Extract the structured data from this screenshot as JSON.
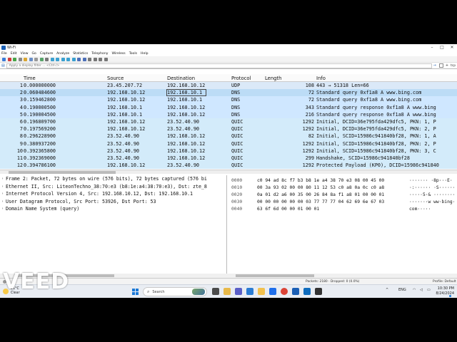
{
  "window": {
    "title": "Wi-Fi"
  },
  "menu": [
    "File",
    "Edit",
    "View",
    "Go",
    "Capture",
    "Analyze",
    "Statistics",
    "Telephony",
    "Wireless",
    "Tools",
    "Help"
  ],
  "filter": {
    "placeholder": "Apply a display filter … <Ctrl-/>",
    "right_label": "tcp"
  },
  "columns": [
    "Time",
    "Source",
    "Destination",
    "Protocol",
    "Length",
    "Info"
  ],
  "packets": [
    {
      "no": "1",
      "time": "0.000000000",
      "src": "23.45.207.72",
      "dst": "192.168.10.12",
      "proto": "UDP",
      "len": "108",
      "info": "443 → 51318 Len=66",
      "kind": "udp"
    },
    {
      "no": "2",
      "time": "0.060484600",
      "src": "192.168.10.12",
      "dst": "192.168.10.1",
      "proto": "DNS",
      "len": "72",
      "info": "Standard query 0xf1a8 A www.bing.com",
      "kind": "sel"
    },
    {
      "no": "3",
      "time": "0.159462800",
      "src": "192.168.10.12",
      "dst": "192.168.10.1",
      "proto": "DNS",
      "len": "72",
      "info": "Standard query 0xf1a8 A www.bing.com",
      "kind": "dns"
    },
    {
      "no": "4",
      "time": "0.190000500",
      "src": "192.168.10.1",
      "dst": "192.168.10.12",
      "proto": "DNS",
      "len": "343",
      "info": "Standard query response 0xf1a8 A www.bing",
      "kind": "dns"
    },
    {
      "no": "5",
      "time": "0.190004500",
      "src": "192.168.10.1",
      "dst": "192.168.10.12",
      "proto": "DNS",
      "len": "216",
      "info": "Standard query response 0xf1a8 A www.bing",
      "kind": "dns"
    },
    {
      "no": "6",
      "time": "0.196809700",
      "src": "192.168.10.12",
      "dst": "23.52.40.90",
      "proto": "QUIC",
      "len": "1292",
      "info": "Initial, DCID=36e795fda429dfc5, PKN: 1, P",
      "kind": "quic"
    },
    {
      "no": "7",
      "time": "0.197569200",
      "src": "192.168.10.12",
      "dst": "23.52.40.90",
      "proto": "QUIC",
      "len": "1292",
      "info": "Initial, DCID=36e795fda429dfc5, PKN: 2, P",
      "kind": "quic"
    },
    {
      "no": "8",
      "time": "0.296228900",
      "src": "23.52.40.90",
      "dst": "192.168.10.12",
      "proto": "QUIC",
      "len": "82",
      "info": "Initial, SCID=15986c941840bf28, PKN: 1, A",
      "kind": "quic"
    },
    {
      "no": "9",
      "time": "0.380937200",
      "src": "23.52.40.90",
      "dst": "192.168.10.12",
      "proto": "QUIC",
      "len": "1292",
      "info": "Initial, SCID=15986c941840bf28, PKN: 2, P",
      "kind": "quic"
    },
    {
      "no": "10",
      "time": "0.392365800",
      "src": "23.52.40.90",
      "dst": "192.168.10.12",
      "proto": "QUIC",
      "len": "1292",
      "info": "Initial, SCID=15986c941840bf28, PKN: 3, C",
      "kind": "quic"
    },
    {
      "no": "11",
      "time": "0.392369000",
      "src": "23.52.40.90",
      "dst": "192.168.10.12",
      "proto": "QUIC",
      "len": "299",
      "info": "Handshake, SCID=15986c941840bf28",
      "kind": "quic"
    },
    {
      "no": "12",
      "time": "0.394786100",
      "src": "192.168.10.12",
      "dst": "23.52.40.90",
      "proto": "QUIC",
      "len": "1292",
      "info": "Protected Payload (KP0), DCID=15986c941840",
      "kind": "quic"
    }
  ],
  "details": [
    "Frame 2: Packet, 72 bytes on wire (576 bits), 72 bytes captured (576 bi",
    "Ethernet II, Src: LiteonTechno_38:70:e3 (b8:1e:a4:38:70:e3), Dst: zte_8",
    "Internet Protocol Version 4, Src: 192.168.10.12, Dst: 192.168.10.1",
    "User Datagram Protocol, Src Port: 53926, Dst Port: 53",
    "Domain Name System (query)"
  ],
  "bytes": [
    {
      "off": "0000",
      "hex": "c0 94 ad 8c f7 b3 b8 1e  a4 38 70 e3 08 00 45 00",
      "ascii": "·······  ·8p···E·"
    },
    {
      "off": "0010",
      "hex": "00 3a 93 02 00 00 80 11  12 53 c0 a8 0a 0c c0 a8",
      "ascii": "·:······ ·S······"
    },
    {
      "off": "0020",
      "hex": "0a 01 d2 a6 00 35 00 26  84 8a f1 a8 01 00 00 01",
      "ascii": "·····5·& ········"
    },
    {
      "off": "0030",
      "hex": "00 00 00 00 00 00 03 77  77 77 04 62 69 6e 67 03",
      "ascii": "·······w ww·bing·"
    },
    {
      "off": "0040",
      "hex": "63 6f 6d 00 00 01 00 01",
      "ascii": "com·····"
    }
  ],
  "status": {
    "counts": "Packets: 2180 · Dropped: 0 (0.0%)",
    "profile": "Profile: Default"
  },
  "taskbar": {
    "weather_temp": "21°C",
    "weather_desc": "Clear",
    "search": "Search",
    "tray_lang": "ENG",
    "time": "10:30 PM",
    "date": "8/24/2024"
  },
  "watermark": "VEED",
  "colors": {
    "dns": "#cfe7ff",
    "quic": "#d3ebfa",
    "udp": "#dbe9f8",
    "selected": "#bcdcf6",
    "accent": "#1a5fb4"
  }
}
